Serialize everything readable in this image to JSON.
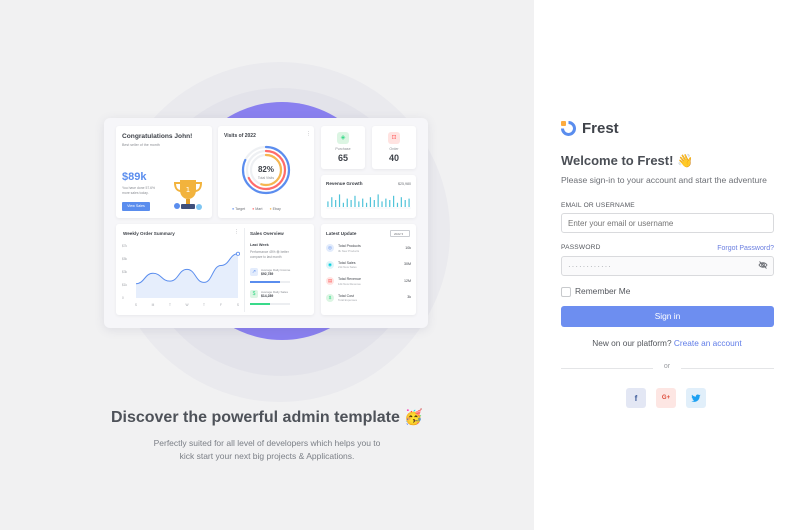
{
  "illustration": {
    "title": "Discover the powerful admin template",
    "title_emoji": "🥳",
    "subtitle_line1": "Perfectly suited for all level of developers which helps you to",
    "subtitle_line2": "kick start your next big projects & Applications.",
    "dashboard": {
      "congrats_title": "Congratulations John!",
      "congrats_sub": "Best seller of the month",
      "congrats_amount": "$89k",
      "congrats_note1": "You have done 57.6%",
      "congrats_note2": "more sales today.",
      "congrats_button": "View Sales",
      "visits_title": "Visits of 2022",
      "visits_percent": "82%",
      "visits_percent_label": "Total Visits",
      "visits_legend": [
        "Target",
        "Mart",
        "Ebay"
      ],
      "visits_rings": [
        {
          "name": "Target",
          "value": 0.82,
          "color": "#5b8def"
        },
        {
          "name": "Mart",
          "value": 0.68,
          "color": "#ff6b6b"
        },
        {
          "name": "Ebay",
          "value": 0.55,
          "color": "#f6b64f"
        }
      ],
      "purchase_label": "Purchase",
      "purchase_value": "65",
      "order_label": "Order",
      "order_value": "40",
      "revenue_title": "Revenue Growth",
      "revenue_value": "$25,980",
      "revenue_bars": [
        0.4,
        0.7,
        0.5,
        0.9,
        0.3,
        0.6,
        0.5,
        0.8,
        0.4,
        0.6,
        0.3,
        0.7,
        0.5,
        0.9,
        0.4,
        0.6,
        0.5,
        0.8,
        0.3,
        0.7,
        0.5,
        0.6
      ],
      "weekly_title": "Weekly Order Summary",
      "weekly_y": [
        "$7k",
        "$5k",
        "$3k",
        "$1k",
        "0"
      ],
      "weekly_x": [
        "S",
        "M",
        "T",
        "W",
        "T",
        "F",
        "S"
      ],
      "weekly_values": [
        2.2,
        3.8,
        2.6,
        4.4,
        2.4,
        5.0,
        6.8
      ],
      "sales_title": "Sales Overview",
      "sales_week": "Last Week",
      "sales_line1": "Performance 45% 😎 better",
      "sales_line2": "compare to last month",
      "sales_item1_label": "Average Daily Income",
      "sales_item1_value": "$92,789",
      "sales_item1_progress": 0.75,
      "sales_item2_label": "Average Daily Sales",
      "sales_item2_value": "$14,289",
      "sales_item2_progress": 0.5,
      "latest_title": "Latest Update",
      "latest_year": "2022",
      "latest_items": [
        {
          "title": "Total Products",
          "sub": "3k New Products",
          "value": "10k"
        },
        {
          "title": "Total Sales",
          "sub": "21k New Sales",
          "value": "30M"
        },
        {
          "title": "Total Revenue",
          "sub": "12k New Revenue",
          "value": "12M"
        },
        {
          "title": "Total Cost",
          "sub": "Total Expenses",
          "value": "3k"
        }
      ]
    }
  },
  "login": {
    "brand": "Frest",
    "welcome": "Welcome to Frest! 👋",
    "welcome_sub": "Please sign-in to your account and start the adventure",
    "email_label": "EMAIL OR USERNAME",
    "email_placeholder": "Enter your email or username",
    "password_label": "PASSWORD",
    "forgot": "Forgot Password?",
    "password_value": "············",
    "remember": "Remember Me",
    "signin": "Sign in",
    "new_text": "New on our platform?",
    "create_account": "Create an account",
    "or": "or",
    "social": [
      "f",
      "G+",
      "t"
    ]
  },
  "colors": {
    "primary": "#6d8ef0",
    "brand": "#5a8dee",
    "disc": "#7367f0"
  }
}
